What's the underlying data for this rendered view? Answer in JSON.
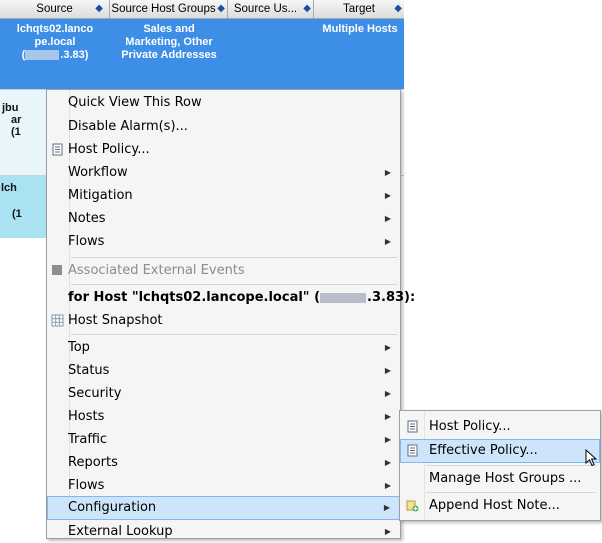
{
  "table": {
    "headers": [
      "Source",
      "Source Host Groups",
      "Source Us...",
      "Target"
    ],
    "selected_row": {
      "source_line1": "lchqts02.lanco",
      "source_line2": "pe.local",
      "source_ip_suffix": ".3.83)",
      "host_groups_line1": "Sales and",
      "host_groups_line2": "Marketing, Other",
      "host_groups_line3": "Private Addresses",
      "target": "Multiple Hosts"
    },
    "row2_fragments": [
      "jbu",
      "ar",
      "(1"
    ],
    "row3_fragments": [
      "lch",
      "(1"
    ]
  },
  "context_menu": {
    "items": [
      {
        "label": "Quick View This Row",
        "submenu": false
      },
      {
        "label": "Disable Alarm(s)...",
        "submenu": false
      },
      {
        "label": "Host Policy...",
        "submenu": false,
        "icon": "document-icon"
      },
      {
        "label": "Workflow",
        "submenu": true
      },
      {
        "label": "Mitigation",
        "submenu": true
      },
      {
        "label": "Notes",
        "submenu": true
      },
      {
        "label": "Flows",
        "submenu": true
      }
    ],
    "associated": {
      "label": "Associated External Events",
      "disabled": true
    },
    "host_header": {
      "prefix": "for Host \"lchqts02.lancope.local\" (",
      "ip_suffix": ".3.83):"
    },
    "host_snapshot": "Host Snapshot",
    "host_items": [
      {
        "label": "Top",
        "submenu": true
      },
      {
        "label": "Status",
        "submenu": true
      },
      {
        "label": "Security",
        "submenu": true
      },
      {
        "label": "Hosts",
        "submenu": true
      },
      {
        "label": "Traffic",
        "submenu": true
      },
      {
        "label": "Reports",
        "submenu": true
      },
      {
        "label": "Flows",
        "submenu": true
      },
      {
        "label": "Configuration",
        "submenu": true,
        "active": true
      },
      {
        "label": "External Lookup",
        "submenu": true
      }
    ]
  },
  "submenu": {
    "items": [
      {
        "label": "Host Policy...",
        "icon": "document-icon"
      },
      {
        "label": "Effective Policy...",
        "icon": "document-icon",
        "active": true
      },
      {
        "label": "Manage Host Groups ..."
      },
      {
        "label": "Append Host Note...",
        "icon": "note-add-icon"
      }
    ]
  },
  "colors": {
    "selected_row": "#3d8ee6",
    "menu_bg": "#f5f5f5",
    "highlight": "#cde4fb",
    "highlight_border": "#84b7ec"
  }
}
